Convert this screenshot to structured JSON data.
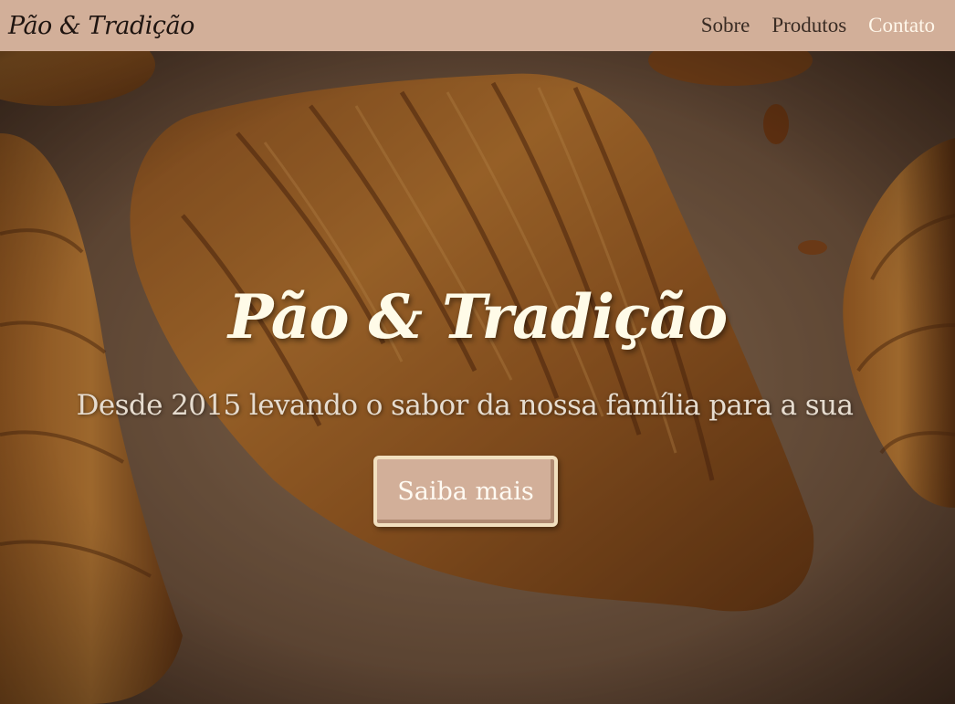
{
  "brand": {
    "name": "Pão & Tradição"
  },
  "nav": {
    "items": [
      {
        "label": "Sobre",
        "active": false
      },
      {
        "label": "Produtos",
        "active": false
      },
      {
        "label": "Contato",
        "active": true
      }
    ]
  },
  "hero": {
    "title": "Pão & Tradição",
    "subtitle": "Desde 2015 levando o sabor da nossa família para a sua",
    "cta_label": "Saiba mais",
    "background_image": "croissants-photo"
  },
  "colors": {
    "navbar_bg": "#d2af99",
    "button_bg": "#d2af99",
    "button_border": "#f2e0bf",
    "title_color": "#fffbe8",
    "active_link": "#fff7ea"
  }
}
